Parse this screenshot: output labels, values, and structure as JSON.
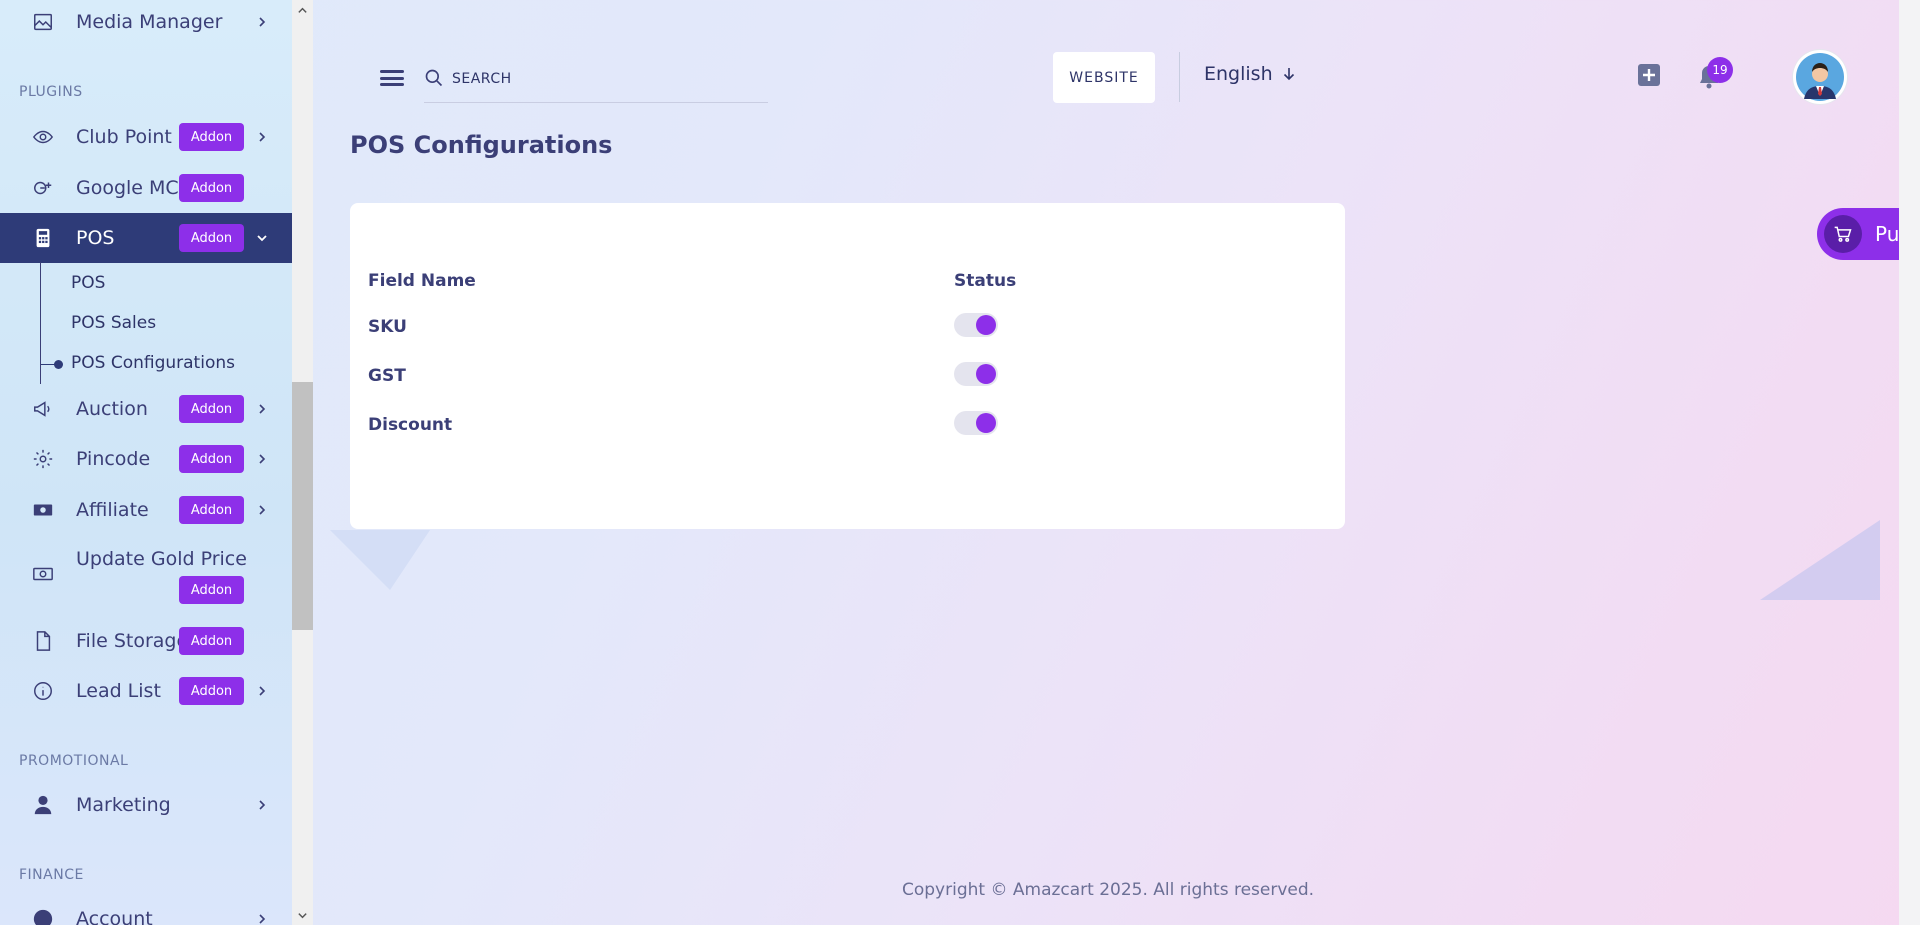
{
  "sidebar": {
    "top_item": {
      "label": "Media Manager",
      "icon": "image-icon"
    },
    "sections": {
      "plugins": "PLUGINS",
      "promotional": "PROMOTIONAL",
      "finance": "FINANCE"
    },
    "items": [
      {
        "label": "Club Point",
        "addon": "Addon",
        "icon": "eye-icon"
      },
      {
        "label": "Google MC",
        "addon": "Addon",
        "icon": "google-plus-icon"
      },
      {
        "label": "POS",
        "addon": "Addon",
        "icon": "calculator-icon",
        "active": true
      },
      {
        "label": "Auction",
        "addon": "Addon",
        "icon": "megaphone-icon"
      },
      {
        "label": "Pincode",
        "addon": "Addon",
        "icon": "gear-icon"
      },
      {
        "label": "Affiliate",
        "addon": "Addon",
        "icon": "money-icon"
      },
      {
        "label": "Update Gold Price",
        "addon": "Addon",
        "icon": "cash-icon"
      },
      {
        "label": "File Storage",
        "addon": "Addon",
        "icon": "file-icon"
      },
      {
        "label": "Lead List",
        "addon": "Addon",
        "icon": "info-icon"
      }
    ],
    "pos_sub": [
      "POS",
      "POS Sales",
      "POS Configurations"
    ],
    "promotional_items": [
      {
        "label": "Marketing",
        "icon": "user-icon"
      }
    ],
    "finance_items": [
      {
        "label": "Account",
        "icon": "dollar-icon"
      }
    ]
  },
  "header": {
    "search_placeholder": "SEARCH",
    "website_button": "WEBSITE",
    "language": "English",
    "notification_count": "19"
  },
  "main": {
    "title": "POS Configurations",
    "table": {
      "headers": [
        "Field Name",
        "Status"
      ],
      "rows": [
        {
          "field": "SKU",
          "enabled": true
        },
        {
          "field": "GST",
          "enabled": true
        },
        {
          "field": "Discount",
          "enabled": true
        }
      ]
    },
    "floating_button": "Pu"
  },
  "footer": {
    "copyright": "Copyright © Amazcart 2025. All rights reserved."
  },
  "colors": {
    "accent": "#8d2fe9",
    "active_nav": "#2e3b78",
    "text": "#3b3f77"
  }
}
